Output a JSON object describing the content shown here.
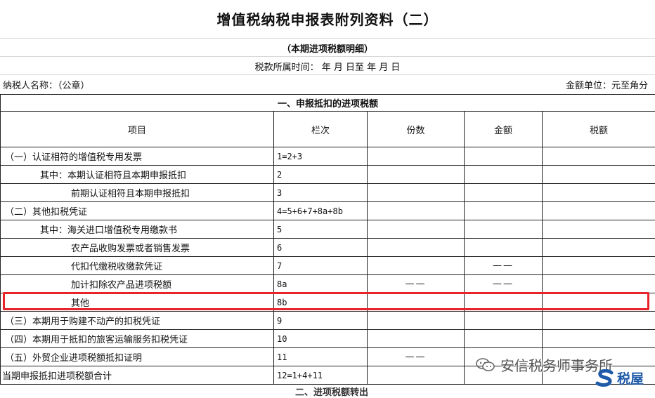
{
  "title": "增值税纳税申报表附列资料（二）",
  "subtitle": "（本期进项税额明细）",
  "period": "税款所属时间：  年      月    日至       年      月      日",
  "taxpayer_label": "纳税人名称：（公章）",
  "unit_label": "金额单位：元至角分",
  "section1": "一、申报抵扣的进项税额",
  "headers": [
    "项目",
    "栏次",
    "份数",
    "金额",
    "税额"
  ],
  "rows": [
    {
      "item": "（一）认证相符的增值税专用发票",
      "code": "1=2+3",
      "count": "",
      "amount": "",
      "tax": ""
    },
    {
      "item": "其中：本期认证相符且本期申报抵扣",
      "code": "2",
      "count": "",
      "amount": "",
      "tax": ""
    },
    {
      "item": "前期认证相符且本期申报抵扣",
      "code": "3",
      "count": "",
      "amount": "",
      "tax": ""
    },
    {
      "item": "（二）其他扣税凭证",
      "code": "4=5+6+7+8a+8b",
      "count": "",
      "amount": "",
      "tax": ""
    },
    {
      "item": "其中：海关进口增值税专用缴款书",
      "code": "5",
      "count": "",
      "amount": "",
      "tax": ""
    },
    {
      "item": "农产品收购发票或者销售发票",
      "code": "6",
      "count": "",
      "amount": "",
      "tax": ""
    },
    {
      "item": "代扣代缴税收缴款凭证",
      "code": "7",
      "count": "",
      "amount": "——",
      "tax": ""
    },
    {
      "item": "加计扣除农产品进项税额",
      "code": "8a",
      "count": "——",
      "amount": "——",
      "tax": ""
    },
    {
      "item": "其他",
      "code": "8b",
      "count": "",
      "amount": "",
      "tax": ""
    },
    {
      "item": "（三）本期用于购建不动产的扣税凭证",
      "code": "9",
      "count": "",
      "amount": "",
      "tax": ""
    },
    {
      "item": "（四）本期用于抵扣的旅客运输服务扣税凭证",
      "code": "10",
      "count": "",
      "amount": "",
      "tax": ""
    },
    {
      "item": "（五）外贸企业进项税额抵扣证明",
      "code": "11",
      "count": "——",
      "amount": "",
      "tax": ""
    },
    {
      "item": "当期申报抵扣进项税额合计",
      "code": "12=1+4+11",
      "count": "",
      "amount": "",
      "tax": ""
    }
  ],
  "cutoff_text": "二、进项税额转出",
  "watermark_text": "安信税务师事务所",
  "brand_text": "税屋",
  "colors": {
    "highlight": "#e8242b",
    "brand": "#1e5aa8"
  }
}
